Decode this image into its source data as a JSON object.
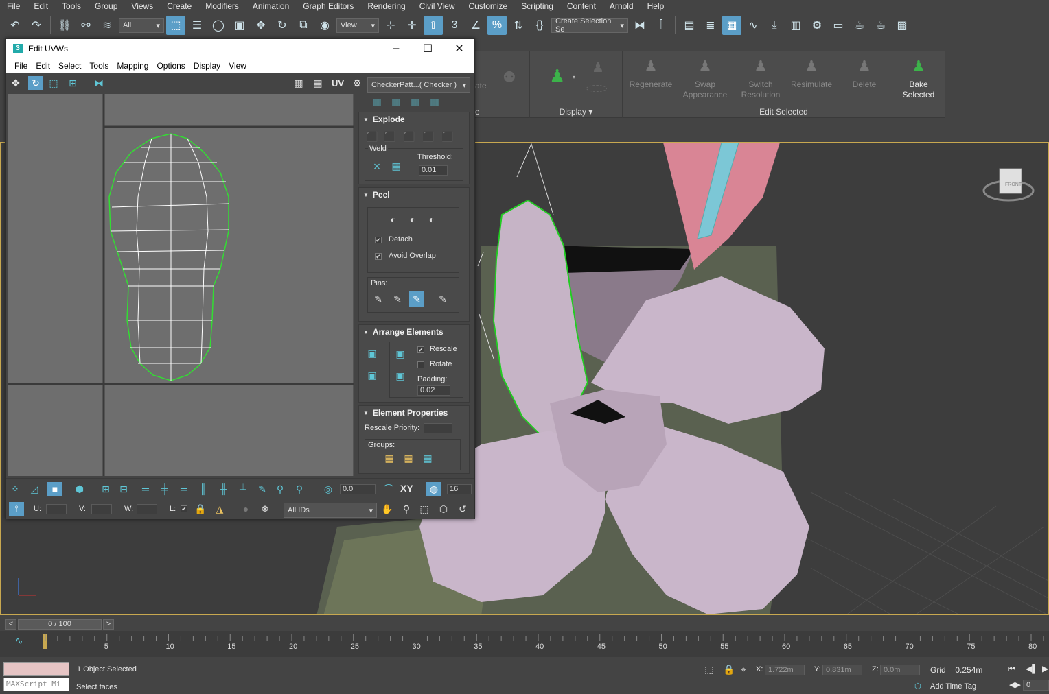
{
  "menubar": [
    "File",
    "Edit",
    "Tools",
    "Group",
    "Views",
    "Create",
    "Modifiers",
    "Animation",
    "Graph Editors",
    "Rendering",
    "Civil View",
    "Customize",
    "Scripting",
    "Content",
    "Arnold",
    "Help"
  ],
  "toolbar": {
    "filter_value": "All",
    "refcoord_value": "View",
    "selection_set_placeholder": "Create Selection Se",
    "snap_label": "3",
    "icons": [
      "undo-icon",
      "redo-icon",
      "link-icon",
      "unlink-icon",
      "bind-spacewarp-icon",
      "select-object-icon",
      "select-by-name-icon",
      "rect-region-icon",
      "window-crossing-icon",
      "move-icon",
      "rotate-icon",
      "scale-icon",
      "placement-icon",
      "pivot-icon",
      "select-manipulate-icon",
      "snap-icon",
      "angle-snap-icon",
      "percent-snap-icon",
      "spinner-snap-icon",
      "named-sets-icon",
      "mirror-icon",
      "align-icon",
      "layer-explorer-icon",
      "toggle-ribbon-icon",
      "curve-editor-icon",
      "schematic-icon",
      "material-editor-icon",
      "render-setup-icon",
      "render-frame-icon",
      "render-icon",
      "render-production-icon",
      "render-active-icon"
    ]
  },
  "ribbon": {
    "groups": [
      {
        "title": "Display",
        "button": "▾"
      },
      {
        "title": "Edit Selected"
      }
    ],
    "buttons": [
      {
        "label": "Regenerate",
        "enabled": false
      },
      {
        "label": "Swap\nAppearance",
        "enabled": false
      },
      {
        "label": "Switch\nResolution",
        "enabled": false
      },
      {
        "label": "Resimulate",
        "enabled": false
      },
      {
        "label": "Delete",
        "enabled": false
      },
      {
        "label": "Bake\nSelected",
        "enabled": true
      }
    ],
    "partial_text": {
      "ate": "ate",
      "e": "e"
    }
  },
  "uvw": {
    "title": "Edit UVWs",
    "menu": [
      "File",
      "Edit",
      "Select",
      "Tools",
      "Mapping",
      "Options",
      "Display",
      "View"
    ],
    "uv_label": "UV",
    "checker_dropdown": "CheckerPatt...( Checker )",
    "explode": {
      "title": "Explode",
      "weld_label": "Weld",
      "threshold_label": "Threshold:",
      "threshold_value": "0.01"
    },
    "peel": {
      "title": "Peel",
      "detach_label": "Detach",
      "detach_checked": true,
      "avoid_overlap_label": "Avoid Overlap",
      "avoid_overlap_checked": true,
      "pins_label": "Pins:"
    },
    "arrange": {
      "title": "Arrange Elements",
      "rescale_label": "Rescale",
      "rescale_checked": true,
      "rotate_label": "Rotate",
      "rotate_checked": false,
      "padding_label": "Padding:",
      "padding_value": "0.02"
    },
    "element_properties": {
      "title": "Element Properties",
      "rescale_priority_label": "Rescale Priority:",
      "groups_label": "Groups:"
    },
    "bottom": {
      "angle_value": "0.0",
      "xy_label": "XY",
      "grid_value": "16",
      "u_label": "U:",
      "v_label": "V:",
      "w_label": "W:",
      "l_label": "L:",
      "ids_value": "All IDs"
    }
  },
  "viewport": {
    "gizmo_label": "FRONT",
    "colors": {
      "petal": "#c8b5c8",
      "petal_edge": "#22cc22",
      "pink": "#d98595",
      "tube": "#7cc7d6",
      "pot": "#6a7258"
    }
  },
  "timeline": {
    "frame_display": "0 / 100",
    "prev": "<",
    "next": ">",
    "ticks": [
      "5",
      "10",
      "15",
      "20",
      "25",
      "30",
      "35",
      "40",
      "45",
      "50",
      "55",
      "60",
      "65",
      "70",
      "75",
      "80"
    ]
  },
  "status": {
    "maxscript": "MAXScript Mi",
    "selected": "1 Object Selected",
    "prompt": "Select faces",
    "x_label": "X:",
    "x_value": "1.722m",
    "y_label": "Y:",
    "y_value": "0.831m",
    "z_label": "Z:",
    "z_value": "0.0m",
    "grid": "Grid = 0.254m",
    "add_time_tag": "Add Time Tag",
    "frame_value": "0"
  }
}
